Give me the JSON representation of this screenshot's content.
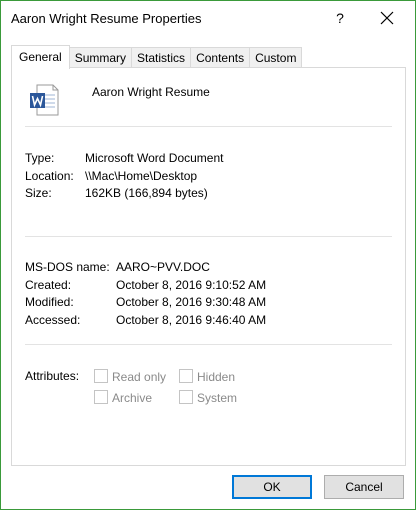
{
  "window": {
    "title": "Aaron Wright Resume Properties",
    "help_label": "?",
    "close_icon": "close-icon"
  },
  "tabs": [
    {
      "label": "General",
      "active": true
    },
    {
      "label": "Summary",
      "active": false
    },
    {
      "label": "Statistics",
      "active": false
    },
    {
      "label": "Contents",
      "active": false
    },
    {
      "label": "Custom",
      "active": false
    }
  ],
  "general": {
    "file_icon": "word-document-icon",
    "file_name": "Aaron Wright Resume",
    "type_label": "Type:",
    "type_value": "Microsoft Word Document",
    "location_label": "Location:",
    "location_value": "\\\\Mac\\Home\\Desktop",
    "size_label": "Size:",
    "size_value": "162KB (166,894 bytes)",
    "msdos_label": "MS-DOS name:",
    "msdos_value": "AARO~PVV.DOC",
    "created_label": "Created:",
    "created_value": "October 8, 2016 9:10:52 AM",
    "modified_label": "Modified:",
    "modified_value": "October 8, 2016 9:30:48 AM",
    "accessed_label": "Accessed:",
    "accessed_value": "October 8, 2016 9:46:40 AM",
    "attributes_label": "Attributes:",
    "attributes": {
      "read_only": {
        "label": "Read only",
        "checked": false
      },
      "hidden": {
        "label": "Hidden",
        "checked": false
      },
      "archive": {
        "label": "Archive",
        "checked": false
      },
      "system": {
        "label": "System",
        "checked": false
      }
    }
  },
  "buttons": {
    "ok_label": "OK",
    "cancel_label": "Cancel"
  },
  "colors": {
    "window_border": "#3a9a3a",
    "accent": "#0078d7",
    "word_blue": "#2b579a"
  }
}
